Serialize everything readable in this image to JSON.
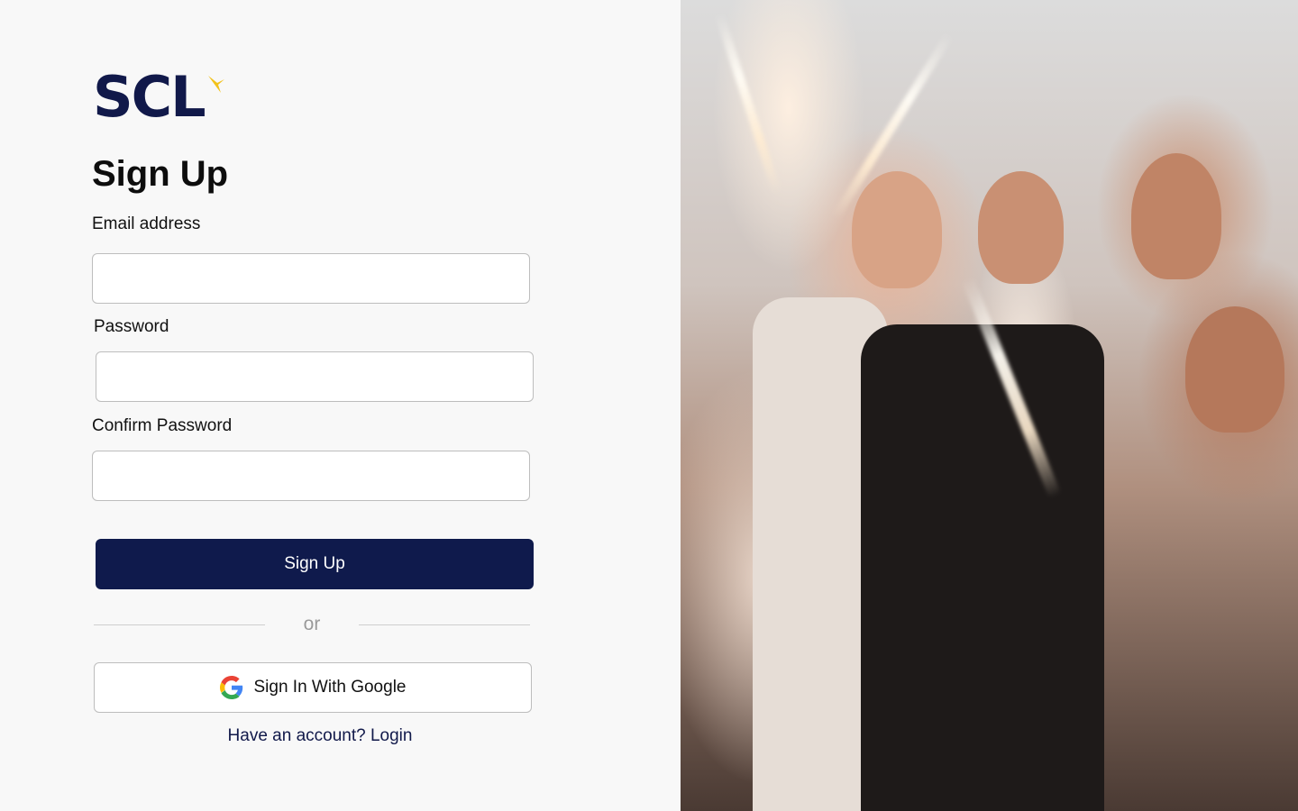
{
  "brand": {
    "logo_text": "SCL",
    "accent_color": "#f2c21b",
    "primary_color": "#0f1a4c"
  },
  "form": {
    "title": "Sign Up",
    "email_label": "Email address",
    "email_value": "",
    "password_label": "Password",
    "password_value": "",
    "confirm_label": "Confirm Password",
    "confirm_value": "",
    "submit_label": "Sign Up",
    "divider_text": "or",
    "google_label": "Sign In With Google",
    "login_link": "Have an account? Login"
  },
  "hero": {
    "image_icon": "party-photo"
  }
}
